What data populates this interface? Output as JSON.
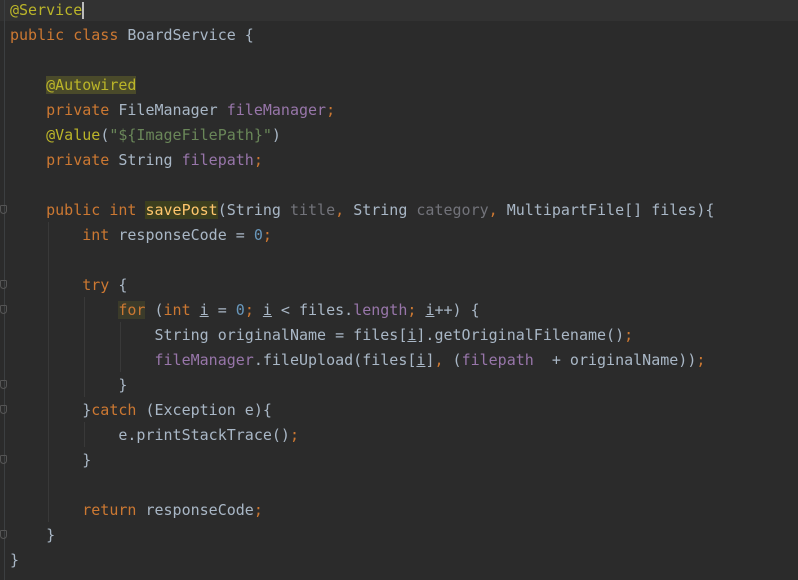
{
  "editor": {
    "language": "Java",
    "theme": "dark",
    "lines": {
      "l1": {
        "at": "@Service"
      },
      "l2": {
        "a": "public class ",
        "b": "BoardService {"
      },
      "l4": {
        "a": "@Autowired"
      },
      "l5": {
        "a": "private ",
        "b": "FileManager ",
        "c": "fileManager",
        "d": ";"
      },
      "l6": {
        "a": "@Value",
        "b": "(",
        "c": "\"${ImageFilePath}\"",
        "d": ")"
      },
      "l7": {
        "a": "private ",
        "b": "String ",
        "c": "filepath",
        "d": ";"
      },
      "l9": {
        "a": "public int ",
        "b": "savePost",
        "c": "(String ",
        "d": "title",
        "e": ", ",
        "f": "String ",
        "g": "category",
        "h": ", ",
        "i": "MultipartFile[] files){"
      },
      "l10": {
        "a": "int ",
        "b": "responseCode = ",
        "c": "0",
        "d": ";"
      },
      "l12": {
        "a": "try ",
        "b": "{"
      },
      "l13": {
        "a": "for",
        "b": " (",
        "c": "int ",
        "d": "i",
        "e": " = ",
        "f": "0",
        "g": "; ",
        "h": "i",
        "i": " < files.",
        "j": "length",
        "k": "; ",
        "l": "i",
        "m": "++) {"
      },
      "l14": {
        "a": "String originalName = files[",
        "b": "i",
        "c": "].getOriginalFilename()",
        "d": ";"
      },
      "l15": {
        "a": "fileManager",
        "b": ".fileUpload(files[",
        "c": "i",
        "d": "]",
        "e": ", ",
        "f": "(",
        "g": "filepath",
        "h": "  + originalName))",
        "i": ";"
      },
      "l16": {
        "a": "}"
      },
      "l17": {
        "a": "}",
        "b": "catch ",
        "c": "(Exception e){"
      },
      "l18": {
        "a": "e.printStackTrace()",
        "b": ";"
      },
      "l19": {
        "a": "}"
      },
      "l21": {
        "a": "return ",
        "b": "responseCode",
        "c": ";"
      },
      "l22": {
        "a": "}"
      },
      "l23": {
        "a": "}"
      }
    },
    "colors": {
      "background": "#2b2b2b",
      "keyword": "#cc7832",
      "annotation": "#bbb529",
      "field": "#9876aa",
      "number": "#6897bb",
      "string": "#6a8759",
      "method": "#ffc66d",
      "text": "#a9b7c6"
    }
  }
}
